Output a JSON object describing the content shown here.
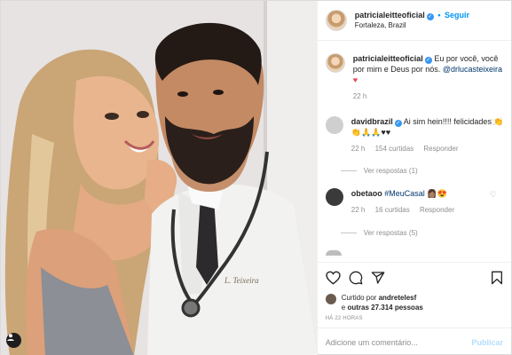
{
  "header": {
    "username": "patricialeitteoficial",
    "follow_separator": "•",
    "follow_label": "Seguir",
    "location": "Fortaleza, Brazil"
  },
  "caption": {
    "username": "patricialeitteoficial",
    "text": "Eu por você, você por mim e Deus por nós.",
    "mention": "@drlucasteixeira",
    "emoji": "♥",
    "time": "22 h"
  },
  "comments": [
    {
      "username": "davidbrazil",
      "text": "Ai sim hein!!!! felicidades 👏👏🙏🙏♥♥",
      "time": "22 h",
      "likes": "154 curtidas",
      "reply": "Responder",
      "view_replies": "Ver respostas (1)"
    },
    {
      "username": "obetaoo",
      "text": "#MeuCasal 👩🏽😍",
      "time": "22 h",
      "likes": "16 curtidas",
      "reply": "Responder",
      "view_replies": "Ver respostas (5)"
    }
  ],
  "likes": {
    "prefix": "Curtido por",
    "user": "andretelesf",
    "connector": "e",
    "others": "outras 27.314 pessoas"
  },
  "timestamp": "HÁ 22 HORAS",
  "comment_box": {
    "placeholder": "Adicione um comentário...",
    "publish_label": "Publicar"
  },
  "photo": {
    "badge_text": "L. Teixeira"
  },
  "colors": {
    "accent": "#0095f6",
    "verified": "#3897f0",
    "heart": "#ed4956",
    "muted": "#8e8e8e"
  },
  "icons": [
    "verified-icon",
    "heart-icon",
    "comment-icon",
    "share-icon",
    "bookmark-icon",
    "tag-user-icon"
  ]
}
